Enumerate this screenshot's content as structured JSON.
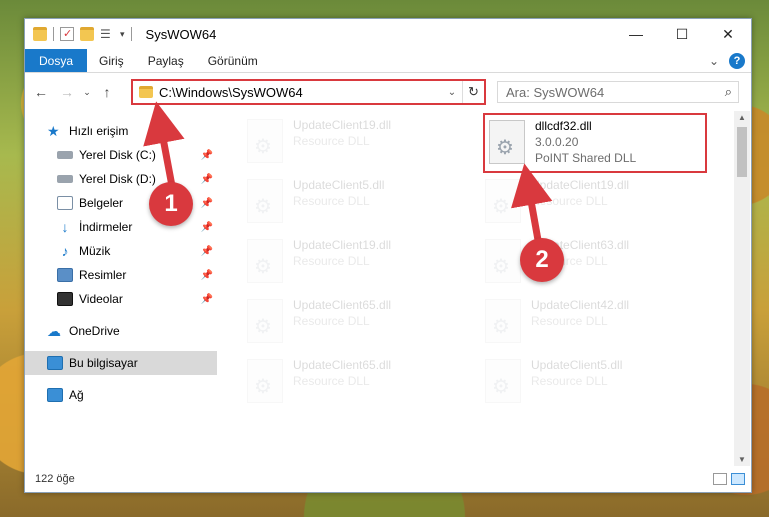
{
  "window": {
    "title": "SysWOW64"
  },
  "ribbon": {
    "tabs": [
      "Dosya",
      "Giriş",
      "Paylaş",
      "Görünüm"
    ]
  },
  "address": {
    "path": "C:\\Windows\\SysWOW64"
  },
  "search": {
    "placeholder": "Ara: SysWOW64"
  },
  "nav": {
    "items": [
      {
        "label": "Hızlı erişim",
        "icon": "star-icon",
        "pinned": false
      },
      {
        "label": "Yerel Disk (C:)",
        "icon": "drive-icon",
        "pinned": true
      },
      {
        "label": "Yerel Disk (D:)",
        "icon": "drive-icon",
        "pinned": true
      },
      {
        "label": "Belgeler",
        "icon": "documents-icon",
        "pinned": true
      },
      {
        "label": "İndirmeler",
        "icon": "download-icon",
        "pinned": true
      },
      {
        "label": "Müzik",
        "icon": "music-icon",
        "pinned": true
      },
      {
        "label": "Resimler",
        "icon": "pictures-icon",
        "pinned": true
      },
      {
        "label": "Videolar",
        "icon": "videos-icon",
        "pinned": true
      },
      {
        "label": "OneDrive",
        "icon": "cloud-icon",
        "pinned": false
      },
      {
        "label": "Bu bilgisayar",
        "icon": "computer-icon",
        "pinned": false
      },
      {
        "label": "Ağ",
        "icon": "network-icon",
        "pinned": false
      }
    ]
  },
  "files": {
    "highlighted": {
      "name": "dllcdf32.dll",
      "version": "3.0.0.20",
      "desc": "PoINT Shared DLL"
    },
    "background": [
      {
        "name": "UpdateClient19.dll",
        "desc": "Resource DLL"
      },
      {
        "name": "UpdateClient5.dll",
        "desc": "Resource DLL"
      },
      {
        "name": "UpdateClient19.dll",
        "desc": "Resource DLL"
      },
      {
        "name": "UpdateClient19.dll",
        "desc": "Resource DLL"
      },
      {
        "name": "UpdateClient63.dll",
        "desc": "Resource DLL"
      },
      {
        "name": "UpdateClient65.dll",
        "desc": "Resource DLL"
      },
      {
        "name": "UpdateClient42.dll",
        "desc": "Resource DLL"
      },
      {
        "name": "UpdateClient65.dll",
        "desc": "Resource DLL"
      },
      {
        "name": "UpdateClient5.dll",
        "desc": "Resource DLL"
      }
    ]
  },
  "status": {
    "count": "122 öğe"
  },
  "annotations": {
    "step1": "1",
    "step2": "2"
  },
  "colors": {
    "accent": "#1979ca",
    "highlight": "#d9393e"
  }
}
